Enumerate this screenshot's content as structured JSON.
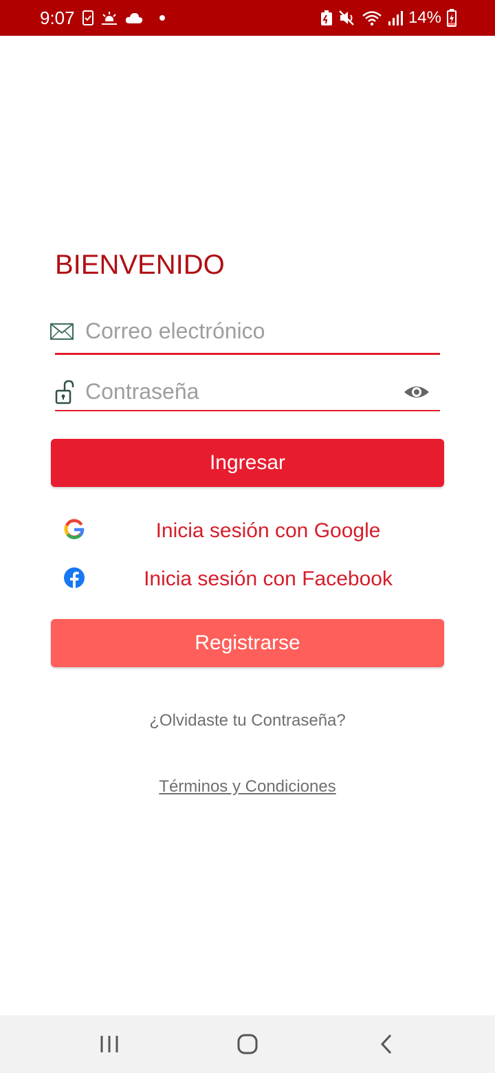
{
  "status_bar": {
    "time": "9:07",
    "battery": "14%",
    "background": "#b00000"
  },
  "welcome": {
    "title": "BIENVENIDO"
  },
  "email": {
    "placeholder": "Correo electrónico",
    "icon": "envelope-icon"
  },
  "password": {
    "placeholder": "Contraseña",
    "icon": "unlocked-padlock-icon",
    "toggle_icon": "eye-icon"
  },
  "buttons": {
    "login": "Ingresar",
    "register": "Registrarse"
  },
  "social": {
    "google": "Inicia sesión con Google",
    "facebook": "Inicia sesión con Facebook"
  },
  "links": {
    "forgot_password": "¿Olvidaste tu Contraseña?",
    "terms": "Términos y Condiciones"
  },
  "colors": {
    "primary": "#e81c2f",
    "secondary": "#ff5f5a",
    "title": "#b00f14",
    "link": "#6f6f6f"
  }
}
